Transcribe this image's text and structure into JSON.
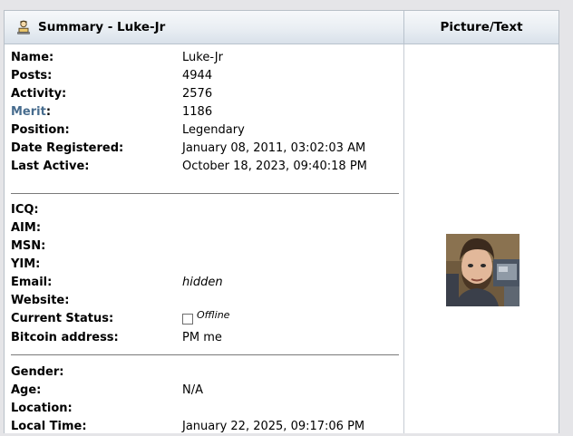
{
  "header": {
    "title": "Summary - Luke-Jr",
    "right_title": "Picture/Text"
  },
  "summary": {
    "name": {
      "label": "Name:",
      "value": "Luke-Jr"
    },
    "posts": {
      "label": "Posts:",
      "value": "4944"
    },
    "activity": {
      "label": "Activity:",
      "value": "2576"
    },
    "merit": {
      "label": "Merit",
      "colon": ":",
      "value": "1186"
    },
    "position": {
      "label": "Position:",
      "value": "Legendary"
    },
    "registered": {
      "label": "Date Registered:",
      "value": "January 08, 2011, 03:02:03 AM"
    },
    "last_active": {
      "label": "Last Active:",
      "value": "October 18, 2023, 09:40:18 PM"
    }
  },
  "contact": {
    "icq": {
      "label": "ICQ:",
      "value": ""
    },
    "aim": {
      "label": "AIM:",
      "value": ""
    },
    "msn": {
      "label": "MSN:",
      "value": ""
    },
    "yim": {
      "label": "YIM:",
      "value": ""
    },
    "email": {
      "label": "Email:",
      "value": "hidden"
    },
    "website": {
      "label": "Website:",
      "value": ""
    },
    "status": {
      "label": "Current Status:",
      "value": "Offline"
    },
    "bitcoin": {
      "label": "Bitcoin address:",
      "value": "PM me"
    }
  },
  "personal": {
    "gender": {
      "label": "Gender:",
      "value": ""
    },
    "age": {
      "label": "Age:",
      "value": "N/A"
    },
    "location": {
      "label": "Location:",
      "value": ""
    },
    "local_time": {
      "label": "Local Time:",
      "value": "January 22, 2025, 09:17:06 PM"
    }
  },
  "icons": {
    "summary_icon": "user-profile-icon",
    "status_icon": "offline-status-icon"
  },
  "colors": {
    "merit_link": "#476c8e",
    "title_bar": "#e9eef3",
    "page_bg": "#e5e5e8"
  }
}
